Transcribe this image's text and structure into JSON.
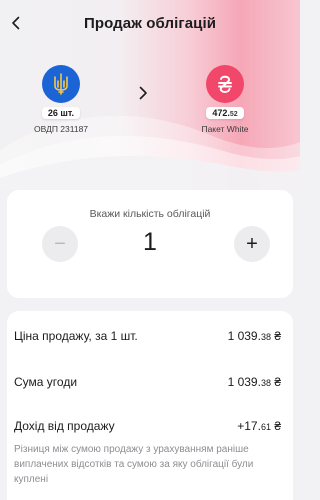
{
  "header": {
    "title": "Продаж облігацій"
  },
  "source_asset": {
    "amount": "26 шт.",
    "name": "ОВДП 231187",
    "icon": "ukraine-trident-icon",
    "color": "#1b64d6"
  },
  "target_asset": {
    "amount_main": "472.",
    "amount_cents": "52",
    "name": "Пакет White",
    "icon": "hryvnia-icon",
    "color": "#f0476a"
  },
  "quantity": {
    "label": "Вкажи кількість облігацій",
    "value": "1",
    "minus": "−",
    "plus": "+"
  },
  "details": {
    "price_label": "Ціна продажу, за 1 шт.",
    "price_main": "1 039.",
    "price_cents": "38",
    "sum_label": "Сума угоди",
    "sum_main": "1 039.",
    "sum_cents": "38",
    "income_label": "Дохід від продажу",
    "income_main": "+17.",
    "income_cents": "61",
    "currency": "₴",
    "hint": "Різниця між сумою продажу з урахуванням раніше виплачених відсотків та сумою за яку облігації були куплені"
  }
}
